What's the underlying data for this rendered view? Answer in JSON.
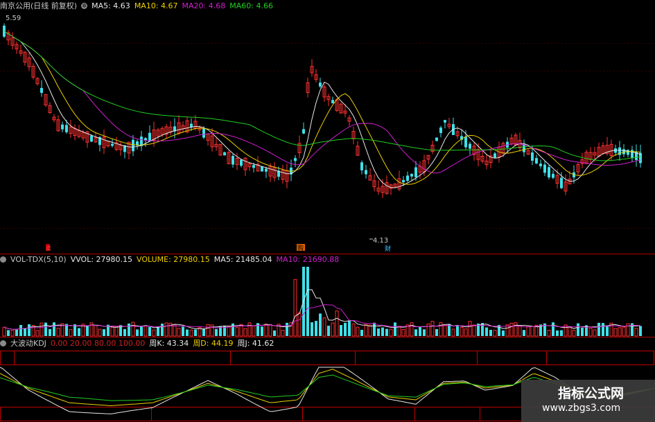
{
  "header": {
    "stock": "南京公用(日线 前复权)",
    "ma": [
      {
        "label": "MA5: 4.63",
        "color": "#e8e8e8"
      },
      {
        "label": "MA10: 4.67",
        "color": "#f0d000"
      },
      {
        "label": "MA20: 4.68",
        "color": "#d020d0"
      },
      {
        "label": "MA60: 4.66",
        "color": "#20d020"
      }
    ]
  },
  "price_panel": {
    "high_label": "5.59",
    "low_label": "4.13",
    "marker_sell": "卖",
    "marker_buy": "购",
    "marker_cai": "财"
  },
  "volume_header": {
    "indicator": "VOL-TDX(5,10)",
    "vvol": "VVOL: 27980.15",
    "volume": "VOLUME: 27980.15",
    "ma5": "MA5: 21485.04",
    "ma10": "MA10: 21690.88"
  },
  "kdj_header": {
    "indicator": "大波动KDJ",
    "levels": "0.00  20.00  80.00  100.00",
    "k": "周K: 43.34",
    "d": "周D: 44.19",
    "j": "周J: 41.62"
  },
  "watermark": {
    "title": "指标公式网",
    "url": "www.zbgs3.com"
  },
  "icons": {
    "gear": "gear-icon",
    "circle": "circle-icon"
  }
}
